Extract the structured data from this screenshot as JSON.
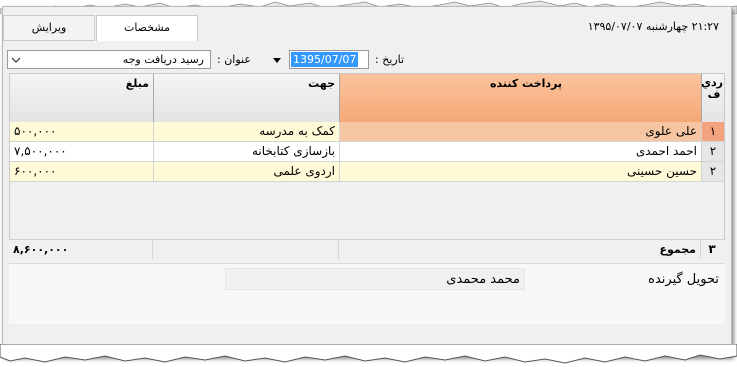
{
  "tabs": {
    "edit": "ویرایش",
    "specs": "مشخصات"
  },
  "header": {
    "datetime": "۲۱:۲۷   چهارشنبه  ۱۳۹۵/۰۷/۰۷"
  },
  "form": {
    "date_label": "تاریخ :",
    "date_value": "1395/07/07",
    "title_label": "عنوان :",
    "title_value": "رسید دریافت وجه"
  },
  "table": {
    "headers": {
      "row": "ردي ف",
      "payer": "پرداخت کننده",
      "purpose": "جهت",
      "amount": "مبلغ"
    },
    "rows": [
      {
        "row": "۱",
        "payer": "علی علوی",
        "purpose": "کمک به مدرسه",
        "amount": "۵۰۰,۰۰۰"
      },
      {
        "row": "۲",
        "payer": "احمد احمدی",
        "purpose": "بازسازی کتابخانه",
        "amount": "۷,۵۰۰,۰۰۰"
      },
      {
        "row": "۲",
        "payer": "حسین حسینی",
        "purpose": "اردوی علمی",
        "amount": "۶۰۰,۰۰۰"
      }
    ],
    "footer": {
      "count": "۳",
      "label": "مجموع",
      "total": "۸,۶۰۰,۰۰۰"
    }
  },
  "receiver": {
    "label": "تحویل گیرنده",
    "name": "محمد محمدی"
  },
  "colors": {
    "header_selected": "#f9a978",
    "row_selected": "#f6c6a3",
    "row_alt": "#fffbd8",
    "row_marker": "#f3a37e"
  }
}
